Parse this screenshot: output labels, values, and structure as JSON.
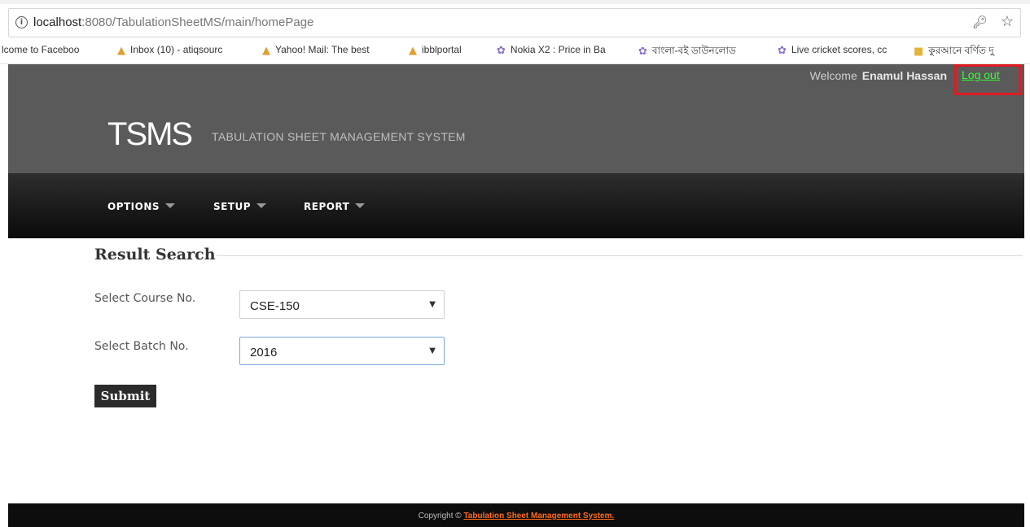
{
  "browser": {
    "url_host": "localhost",
    "url_rest": ":8080/TabulationSheetMS/main/homePage",
    "info_icon": "i",
    "key_icon": "key-icon",
    "star_icon": "star-icon",
    "bookmarks": [
      {
        "label": "lcome to Faceboo",
        "icon": ""
      },
      {
        "label": "Inbox (10) - atiqsourc",
        "icon": "triangle-icon"
      },
      {
        "label": "Yahoo! Mail: The best",
        "icon": "triangle-icon"
      },
      {
        "label": "ibblportal",
        "icon": "triangle-icon"
      },
      {
        "label": "Nokia X2 : Price in Ba",
        "icon": "gear-icon"
      },
      {
        "label": "বাংলা-বই ডাউনলোড",
        "icon": "gear-icon"
      },
      {
        "label": "Live cricket scores, cc",
        "icon": "gear-icon"
      },
      {
        "label": "কুরআনে বর্ণিত দু",
        "icon": "folder-icon"
      }
    ]
  },
  "header": {
    "welcome_text": "Welcome",
    "user_name": "Enamul Hassan",
    "logout_label": "Log out",
    "logo": "TSMS",
    "subtitle": "TABULATION SHEET MANAGEMENT SYSTEM"
  },
  "nav": {
    "items": [
      {
        "label": "OPTIONS"
      },
      {
        "label": "SETUP"
      },
      {
        "label": "REPORT"
      }
    ]
  },
  "form": {
    "legend": "Result Search",
    "course_label": "Select Course No.",
    "course_value": "CSE-150",
    "batch_label": "Select Batch No.",
    "batch_value": "2016",
    "submit_label": "Submit"
  },
  "footer": {
    "copyright": "Copyright ©",
    "link_text": "Tabulation Sheet Management System."
  },
  "colors": {
    "header_bg": "#5a5a5a",
    "nav_bg": "#1a1a1a",
    "logout_link": "#33ff33",
    "highlight_box": "#e01b22",
    "footer_link": "#ff6a1a"
  }
}
